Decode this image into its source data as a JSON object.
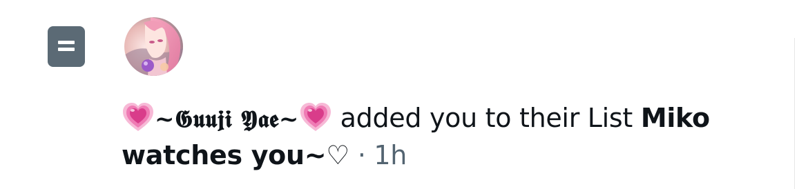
{
  "notification": {
    "icon": "list-icon",
    "avatar_icon": "avatar-image",
    "emoji": "growing-heart-emoji",
    "username": "~𝕲𝖚𝖚𝖏𝖎 𝖄𝖆𝖊~",
    "action_text": " added you to their List ",
    "list_name": "Miko watches you~♡",
    "separator": " · ",
    "time": "1h"
  },
  "colors": {
    "list_icon_bg": "#5b6a75",
    "text": "#0f1419",
    "muted": "#536471",
    "heart_pink": "#e0458f"
  }
}
